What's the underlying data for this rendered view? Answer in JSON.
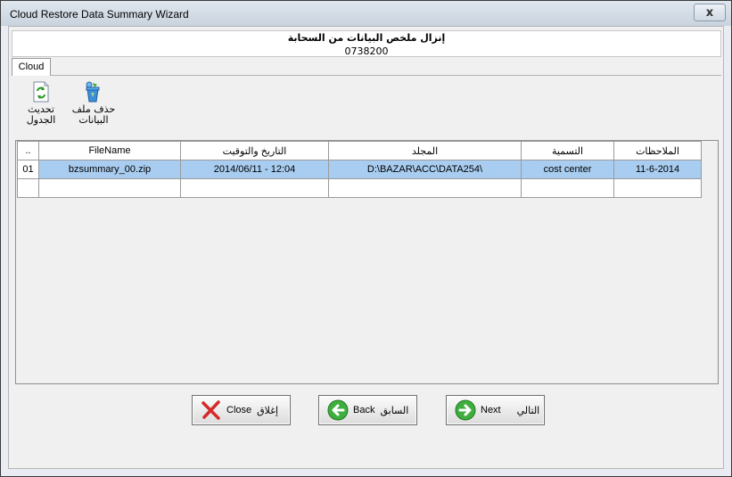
{
  "window": {
    "title": "Cloud Restore Data Summary Wizard",
    "close_glyph": "x"
  },
  "header": {
    "title": "إنزال ملخص البيانات من السحابة",
    "subtitle": "0738200"
  },
  "tab": {
    "label": "Cloud"
  },
  "toolbar": {
    "refresh_line1": "تحديث",
    "refresh_line2": "الجدول",
    "delete_line1": "حذف ملف",
    "delete_line2": "البيانات",
    "refresh_icon": "refresh-icon",
    "delete_icon": "recycle-bin-icon"
  },
  "grid": {
    "columns": [
      "..",
      "FileName",
      "التاريخ والتوقيت",
      "المجلد",
      "التسمية",
      "الملاحظات"
    ],
    "rows": [
      {
        "idx": "01",
        "file": "bzsummary_00.zip",
        "datetime": "2014/06/11 - 12:04",
        "folder": "D:\\BAZAR\\ACC\\DATA254\\",
        "name": "cost center",
        "notes": "11-6-2014"
      }
    ],
    "selected_row_color": "#a9cdf0"
  },
  "buttons": {
    "close_en": "Close",
    "close_ar": "إغلاق",
    "back_en": "Back",
    "back_ar": "السابق",
    "next_en": "Next",
    "next_ar": "التالي",
    "close_icon": "red-x-icon",
    "back_icon": "green-left-arrow-icon",
    "next_icon": "green-right-arrow-icon"
  }
}
